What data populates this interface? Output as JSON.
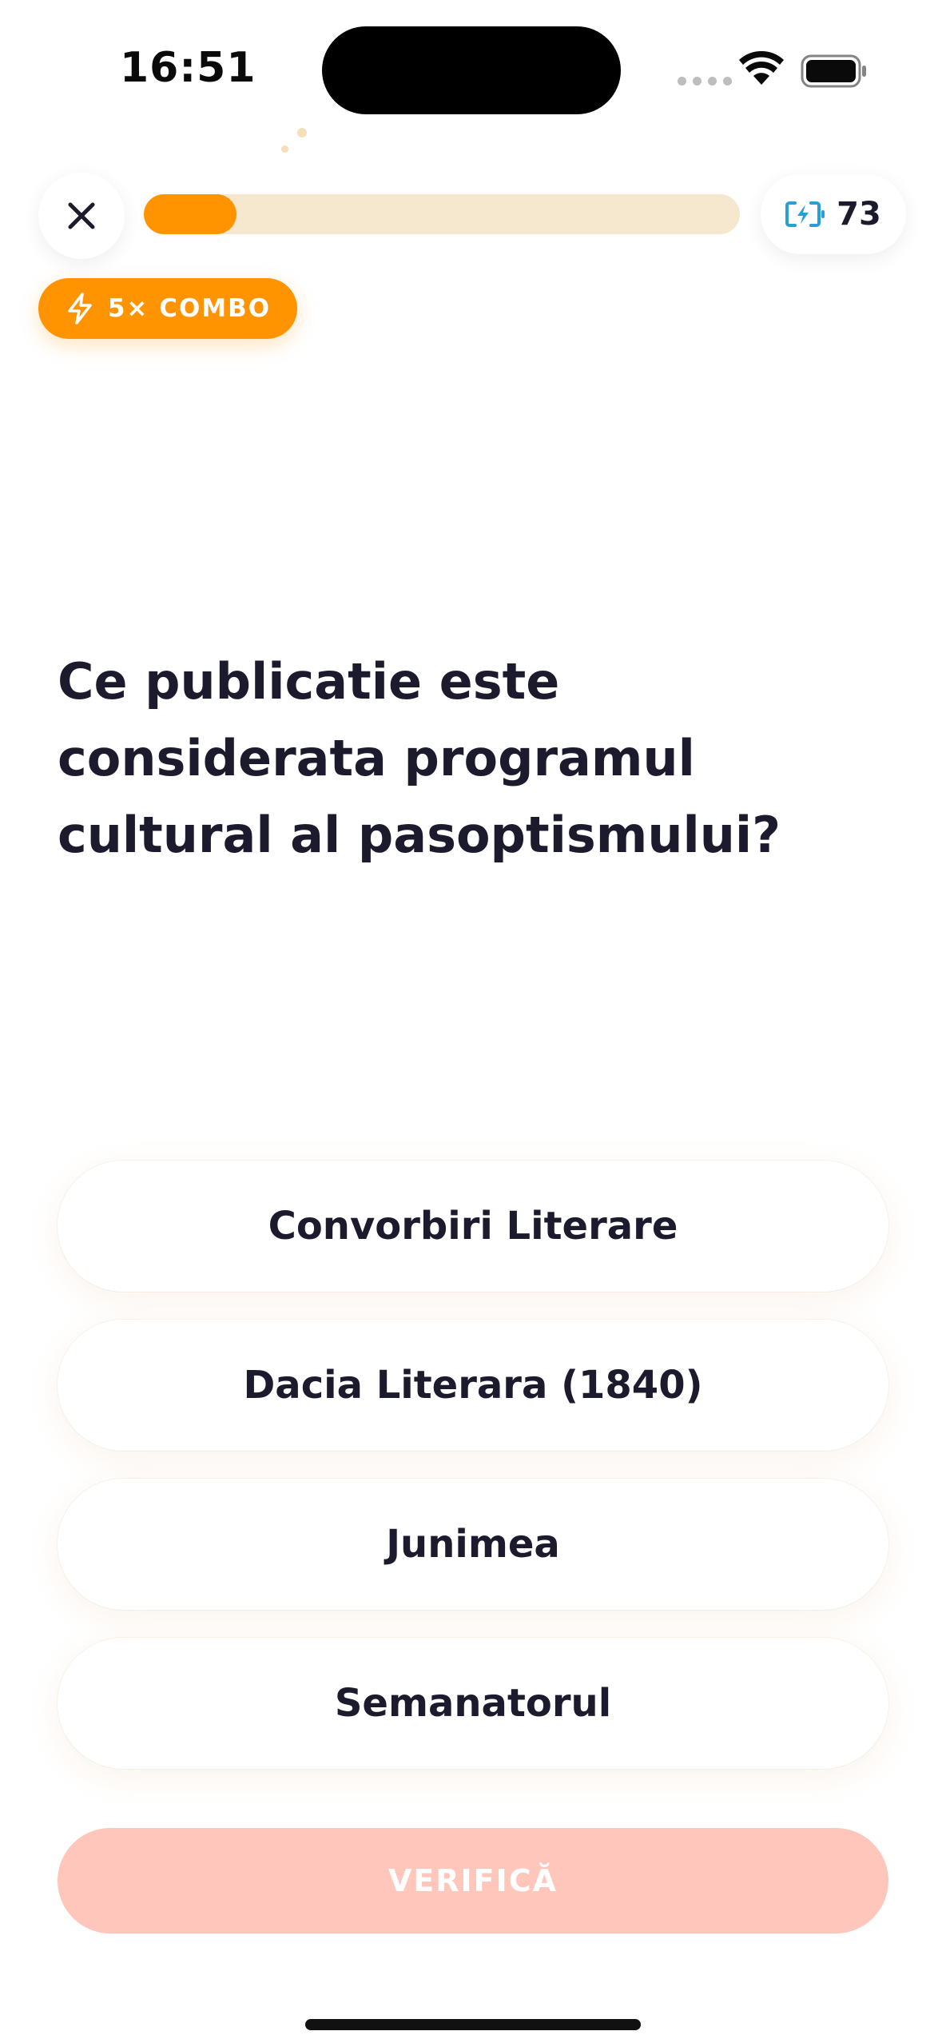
{
  "status_bar": {
    "time": "16:51"
  },
  "lesson": {
    "progress_fraction": 0.155,
    "energy": "73",
    "combo_label": "5× COMBO"
  },
  "question": {
    "text": "Ce publicatie este considerata programul cultural al pasoptismului?"
  },
  "answers": [
    "Convorbiri Literare",
    "Dacia Literara (1840)",
    "Junimea",
    "Semanatorul"
  ],
  "actions": {
    "check_label": "VERIFICĂ"
  },
  "colors": {
    "accent": "#ff9400",
    "progress_track": "#f6e7cf",
    "energy_icon": "#2a9fd6",
    "check_disabled": "#ffc6bb",
    "text": "#1c1b2e"
  },
  "icons": {
    "close": "close-icon",
    "energy": "energy-battery-icon",
    "combo": "lightning-icon"
  }
}
